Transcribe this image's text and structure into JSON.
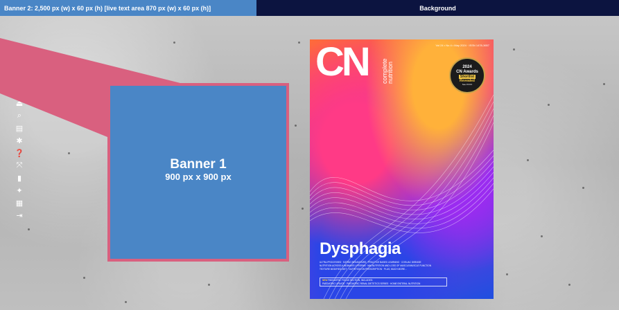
{
  "top_bar": {
    "banner2_label": "Banner 2: 2,500 px (w) x 60 px (h) [live text area 870 px (w) x 60 px (h)]",
    "background_label": "Background"
  },
  "banner1": {
    "title": "Banner 1",
    "size": "900 px x 900 px"
  },
  "toolbar": {
    "icons": [
      "cloud-upload-icon",
      "search-icon",
      "document-icon",
      "gear-icon",
      "help-icon",
      "fullscreen-icon",
      "bookmark-icon",
      "pin-icon",
      "grid-icon",
      "exit-icon"
    ]
  },
  "magazine_cover": {
    "logo": "CN",
    "logo_sub_1": "complete",
    "logo_sub_2": "nutrition",
    "meta": "Vol 24 • No 4 • May 2024 · ISSN 1478-3657",
    "award_year": "2024",
    "award_name": "CN Awards",
    "award_status": "Shortlist",
    "award_status_2": "Revealed",
    "award_page": "See P.XXX",
    "title": "Dysphagia",
    "lines": [
      "ULTRA-PROCESSED · EATING BEHAVIOURS · PRACTICE BASED LEARNING · COELIAC DISEASE",
      "NUTRITION ACROSS A WOMAN'S LIFESPAN · MALNUTRITION AND LOSS OF MUSCLE/MUSCLE FUNCTION",
      "TEXTURE MODIFIED DIET · NUTRITION ON PRESCRIPTION · PLUS, MUCH MORE..."
    ],
    "box_new": "NEW",
    "box_line1": "PAEDIATRIC FOCUS SECTION, INCLUDES:",
    "box_line2": "PAEDIATRIC UPDATE · PAEDIATRIC RENAL DIETETICS SERIES · HOME ENTERAL NUTRITION"
  },
  "colors": {
    "banner_blue": "#4a86c6",
    "navy": "#0c1440",
    "pink": "#d9607f"
  }
}
